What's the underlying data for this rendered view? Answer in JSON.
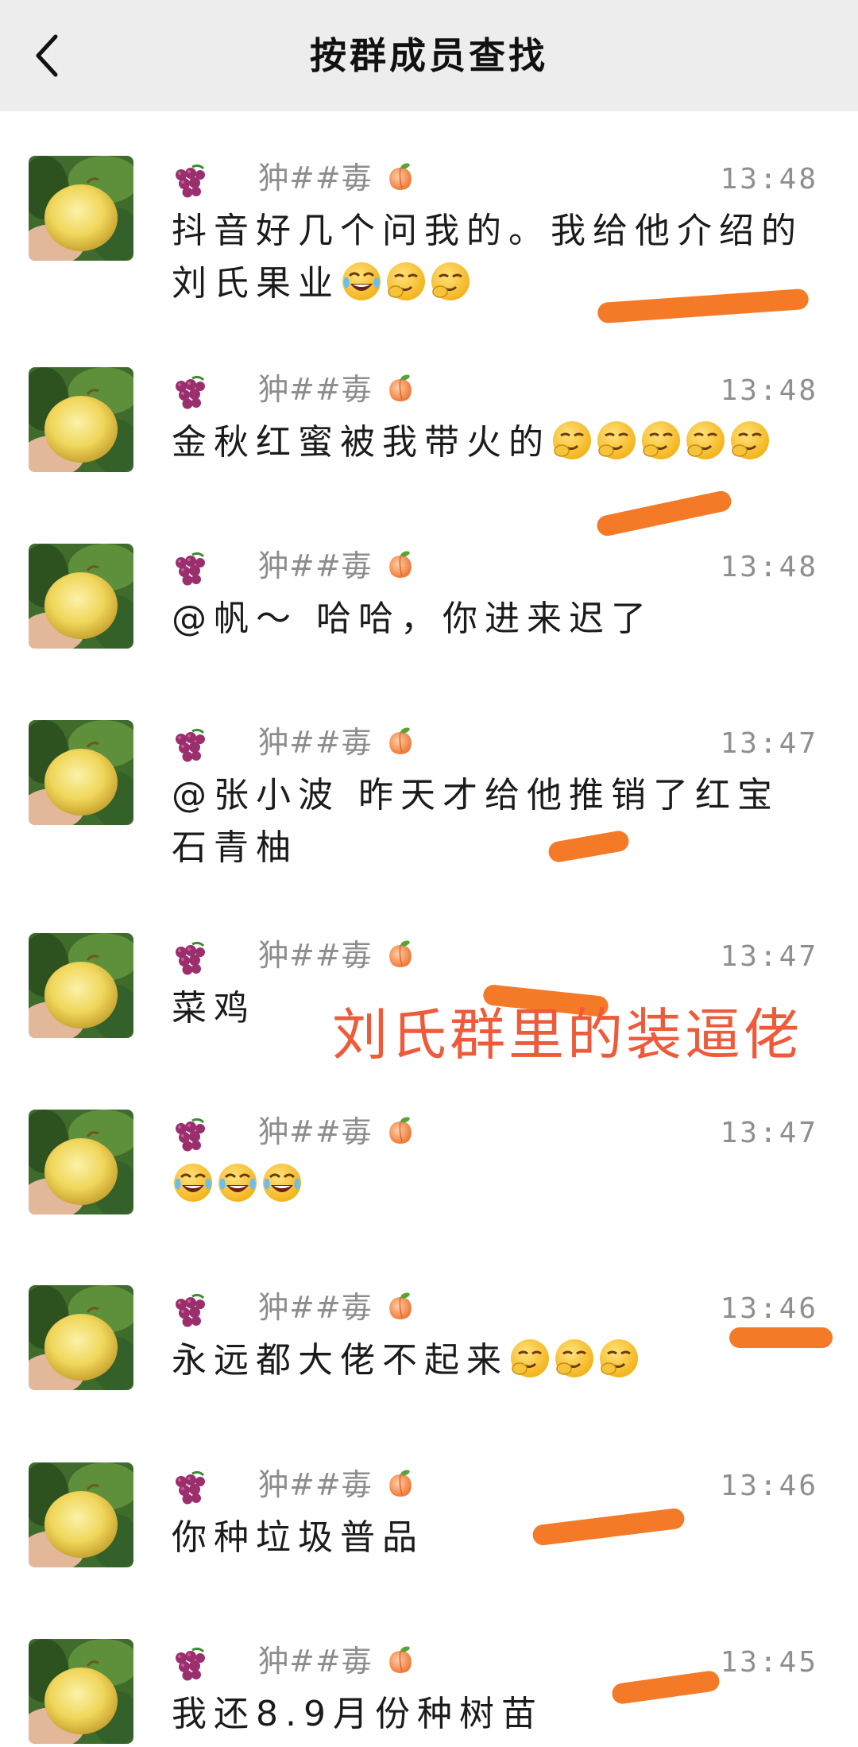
{
  "header": {
    "title": "按群成员查找",
    "back_icon": "chevron-left-icon"
  },
  "messages": [
    {
      "nickname": "狆##毐",
      "time": "13:48",
      "text": "抖音好几个问我的。我给他介绍的刘氏果业",
      "emojis": [
        "crying-laughing",
        "smirk",
        "smirk"
      ]
    },
    {
      "nickname": "狆##毐",
      "time": "13:48",
      "text": "金秋红蜜被我带火的",
      "emojis": [
        "smirk",
        "smirk",
        "smirk",
        "smirk",
        "smirk"
      ]
    },
    {
      "nickname": "狆##毐",
      "time": "13:48",
      "text": "@帆～ 哈哈，你进来迟了",
      "emojis": []
    },
    {
      "nickname": "狆##毐",
      "time": "13:47",
      "text": "@张小波 昨天才给他推销了红宝石青柚",
      "emojis": []
    },
    {
      "nickname": "狆##毐",
      "time": "13:47",
      "text": "菜鸡",
      "emojis": []
    },
    {
      "nickname": "狆##毐",
      "time": "13:47",
      "text": "",
      "emojis": [
        "crying-laughing",
        "crying-laughing",
        "crying-laughing"
      ]
    },
    {
      "nickname": "狆##毐",
      "time": "13:46",
      "text": "永远都大佬不起来",
      "emojis": [
        "smirk",
        "smirk",
        "smirk"
      ]
    },
    {
      "nickname": "狆##毐",
      "time": "13:46",
      "text": "你种垃圾普品",
      "emojis": []
    },
    {
      "nickname": "狆##毐",
      "time": "13:45",
      "text": "我还8.9月份种树苗",
      "emojis": []
    }
  ],
  "overlay": {
    "caption": "刘氏群里的装逼佬",
    "caption_color": "#ee5a3a",
    "scribble_color": "#f47a28"
  },
  "colors": {
    "header_bg": "#ededed",
    "nickname": "#8d8d8d",
    "time": "#8f8f8f"
  }
}
